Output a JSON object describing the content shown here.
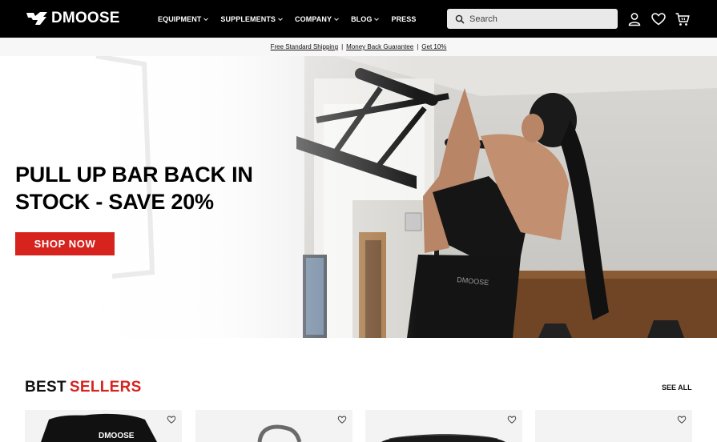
{
  "brand": {
    "name": "DMOOSE"
  },
  "nav": {
    "menu": [
      {
        "label": "EQUIPMENT",
        "dropdown": true
      },
      {
        "label": "SUPPLEMENTS",
        "dropdown": true
      },
      {
        "label": "COMPANY",
        "dropdown": true
      },
      {
        "label": "BLOG",
        "dropdown": true
      },
      {
        "label": "PRESS",
        "dropdown": false
      }
    ],
    "search": {
      "placeholder": "Search",
      "value": ""
    },
    "icons": [
      "search-icon",
      "account-icon",
      "wishlist-heart-icon",
      "cart-icon"
    ]
  },
  "promo": {
    "links": [
      "Free Standard Shipping",
      "Money Back Guarantee",
      "Get 10%"
    ],
    "separator": "|"
  },
  "hero": {
    "title_line1": "PULL UP BAR BACK IN",
    "title_line2": "STOCK - SAVE 20%",
    "cta_label": "SHOP NOW",
    "cta_color": "#d6231e",
    "shorts_print": "DMOOSE"
  },
  "best_sellers": {
    "title_word1": "BEST",
    "title_word2": "SELLERS",
    "accent_color": "#d6231e",
    "see_all_label": "SEE ALL",
    "cards": [
      {
        "print": "DMOOSE",
        "icon": "wishlist-heart-icon"
      },
      {
        "icon": "wishlist-heart-icon"
      },
      {
        "icon": "wishlist-heart-icon"
      },
      {
        "icon": "wishlist-heart-icon"
      }
    ]
  }
}
